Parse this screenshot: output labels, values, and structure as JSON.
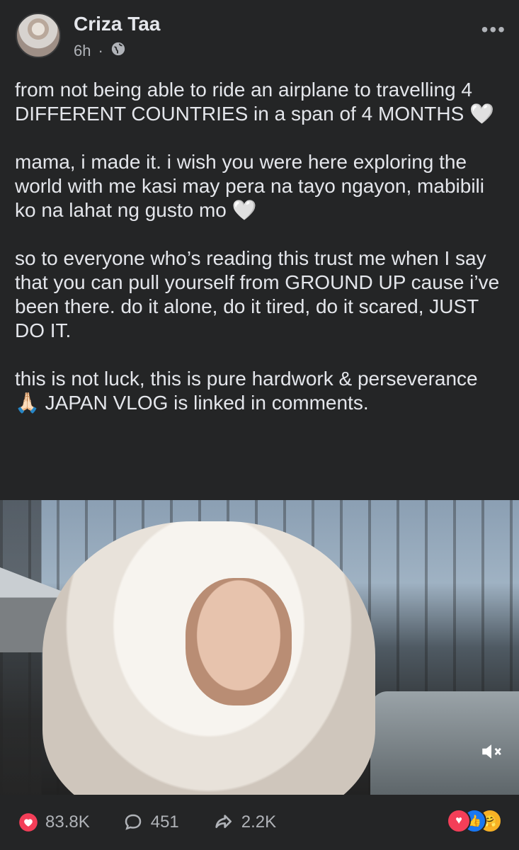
{
  "post": {
    "author": "Criza Taa",
    "time": "6h",
    "separator": "·",
    "text": "from not being able to ride an airplane to travelling 4 DIFFERENT COUNTRIES in a span of 4 MONTHS 🤍\n\nmama, i made it. i wish you were here exploring the world with me kasi may pera na tayo ngayon, mabibili ko na lahat ng gusto mo 🤍\n\nso to everyone who’s reading this trust me when I say that you can pull yourself from GROUND UP cause i’ve been there. do it alone, do it tired, do it scared, JUST DO IT.\n\nthis is not luck, this is pure hardwork & perseverance 🙏🏻 JAPAN VLOG is linked in comments."
  },
  "stats": {
    "likes": "83.8K",
    "comments": "451",
    "shares": "2.2K"
  },
  "icons": {
    "more": "more-horizontal-icon",
    "privacy": "globe-icon",
    "mute": "volume-muted-icon",
    "like": "heart-icon",
    "comment": "comment-bubble-icon",
    "share": "share-arrow-icon"
  },
  "colors": {
    "background": "#242526",
    "text": "#e4e6eb",
    "muted": "#b0b3b8",
    "heart": "#f33e58",
    "like_blue": "#1877f2",
    "care_yellow": "#f7b125"
  }
}
